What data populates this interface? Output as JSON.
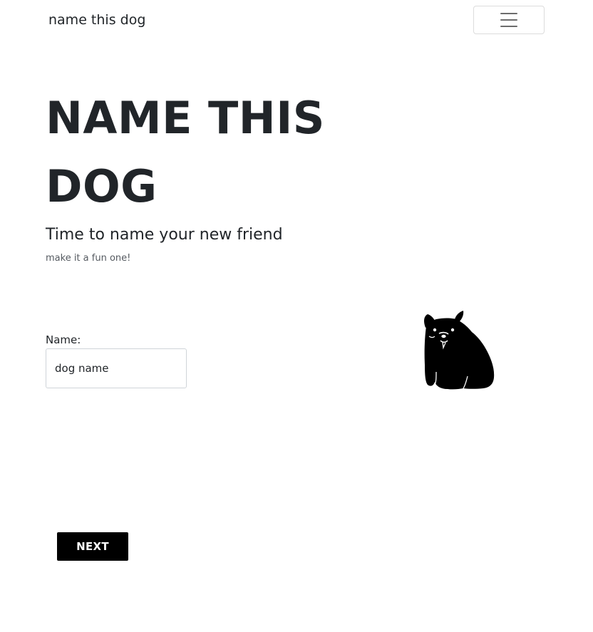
{
  "navbar": {
    "brand": "name this dog",
    "menu_icon": "hamburger-menu-icon"
  },
  "hero": {
    "title": "NAME THIS DOG",
    "subtitle": "Time to name your new friend",
    "helper": "make it a fun one!"
  },
  "form": {
    "label": "Name:",
    "value": "",
    "placeholder": "dog name"
  },
  "illustration": {
    "icon": "dog-illustration"
  },
  "actions": {
    "next_label": "NEXT"
  },
  "colors": {
    "text": "#212529",
    "button_bg": "#000000",
    "button_text": "#ffffff"
  }
}
